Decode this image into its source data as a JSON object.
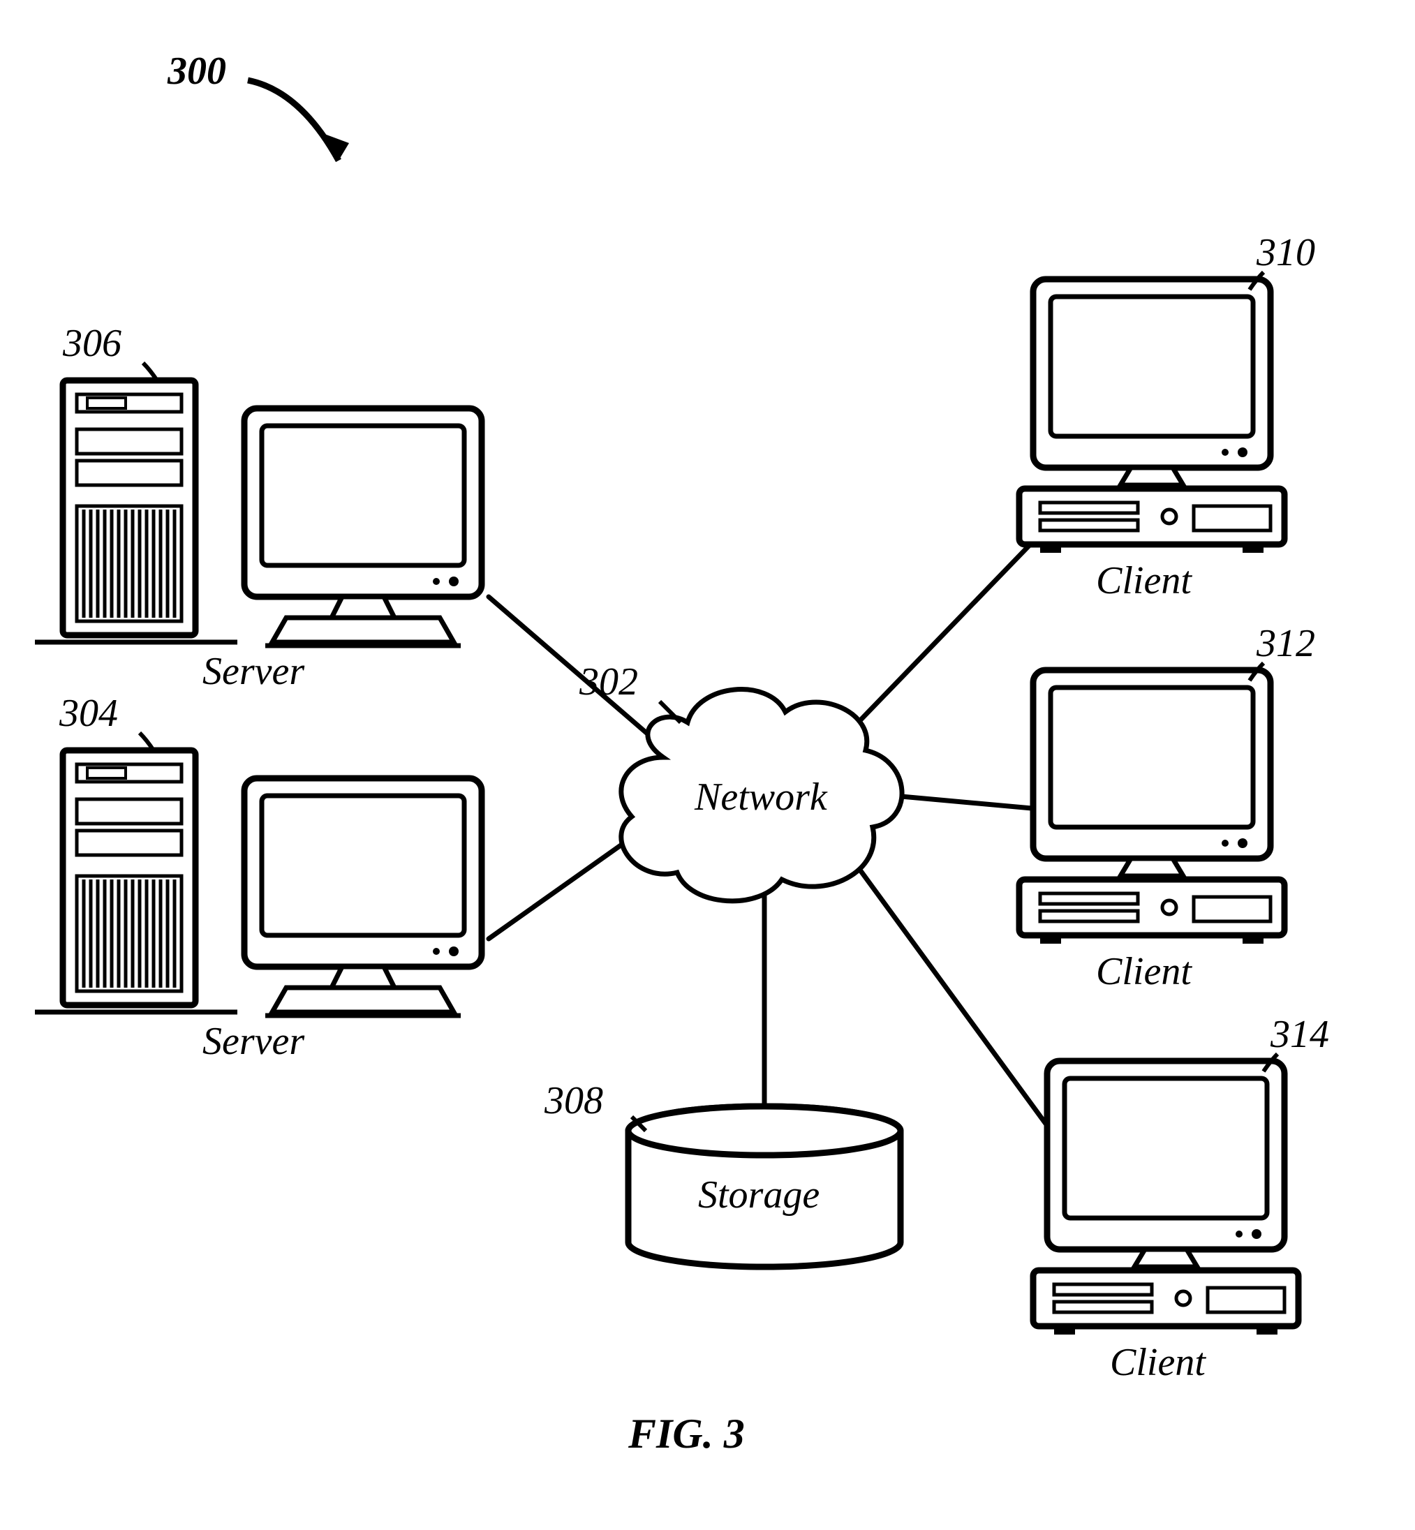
{
  "figure": {
    "number_ref": "300",
    "caption": "FIG. 3"
  },
  "nodes": {
    "network": {
      "ref": "302",
      "label": "Network"
    },
    "server_top": {
      "ref": "306",
      "label": "Server"
    },
    "server_bottom": {
      "ref": "304",
      "label": "Server"
    },
    "storage": {
      "ref": "308",
      "label": "Storage"
    },
    "client_top": {
      "ref": "310",
      "label": "Client"
    },
    "client_mid": {
      "ref": "312",
      "label": "Client"
    },
    "client_bottom": {
      "ref": "314",
      "label": "Client"
    }
  }
}
